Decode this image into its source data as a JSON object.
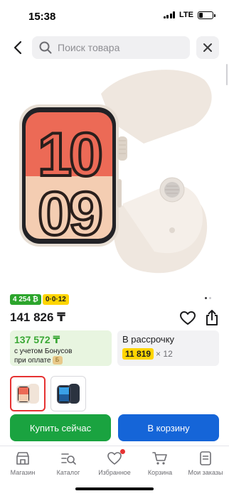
{
  "status_bar": {
    "time": "15:38",
    "network": "LTE"
  },
  "search": {
    "placeholder": "Поиск товара"
  },
  "product": {
    "image_icon": "apple-watch-image",
    "watch_face": {
      "hour": "10",
      "minute": "09"
    },
    "badges": {
      "bonus": "4 254 ₿",
      "installment": "0·0·12"
    },
    "gallery_pages": 2,
    "gallery_active": 1,
    "price": "141 826 ₸",
    "bonus_offer": {
      "price": "137 572 ₸",
      "note_line1": "с учетом Бонусов",
      "note_line2": "при оплате"
    },
    "installment_offer": {
      "title": "В рассрочку",
      "amount": "11 819",
      "multiplier": "× 12"
    },
    "variants": [
      {
        "name": "starlight",
        "color": "#f1e4d8",
        "selected": true
      },
      {
        "name": "midnight",
        "color": "#2b3340",
        "selected": false
      }
    ]
  },
  "actions": {
    "buy_now": "Купить сейчас",
    "add_to_cart": "В корзину"
  },
  "tabbar": {
    "items": [
      {
        "label": "Магазин",
        "icon": "shop-icon"
      },
      {
        "label": "Каталог",
        "icon": "catalog-icon"
      },
      {
        "label": "Избранное",
        "icon": "heart-icon",
        "notification": true
      },
      {
        "label": "Корзина",
        "icon": "cart-icon"
      },
      {
        "label": "Мои заказы",
        "icon": "orders-icon"
      }
    ]
  },
  "colors": {
    "green": "#1aa340",
    "blue": "#1565d8",
    "yellow": "#ffd500",
    "red": "#e63232",
    "bonus_green": "#3aa835"
  }
}
